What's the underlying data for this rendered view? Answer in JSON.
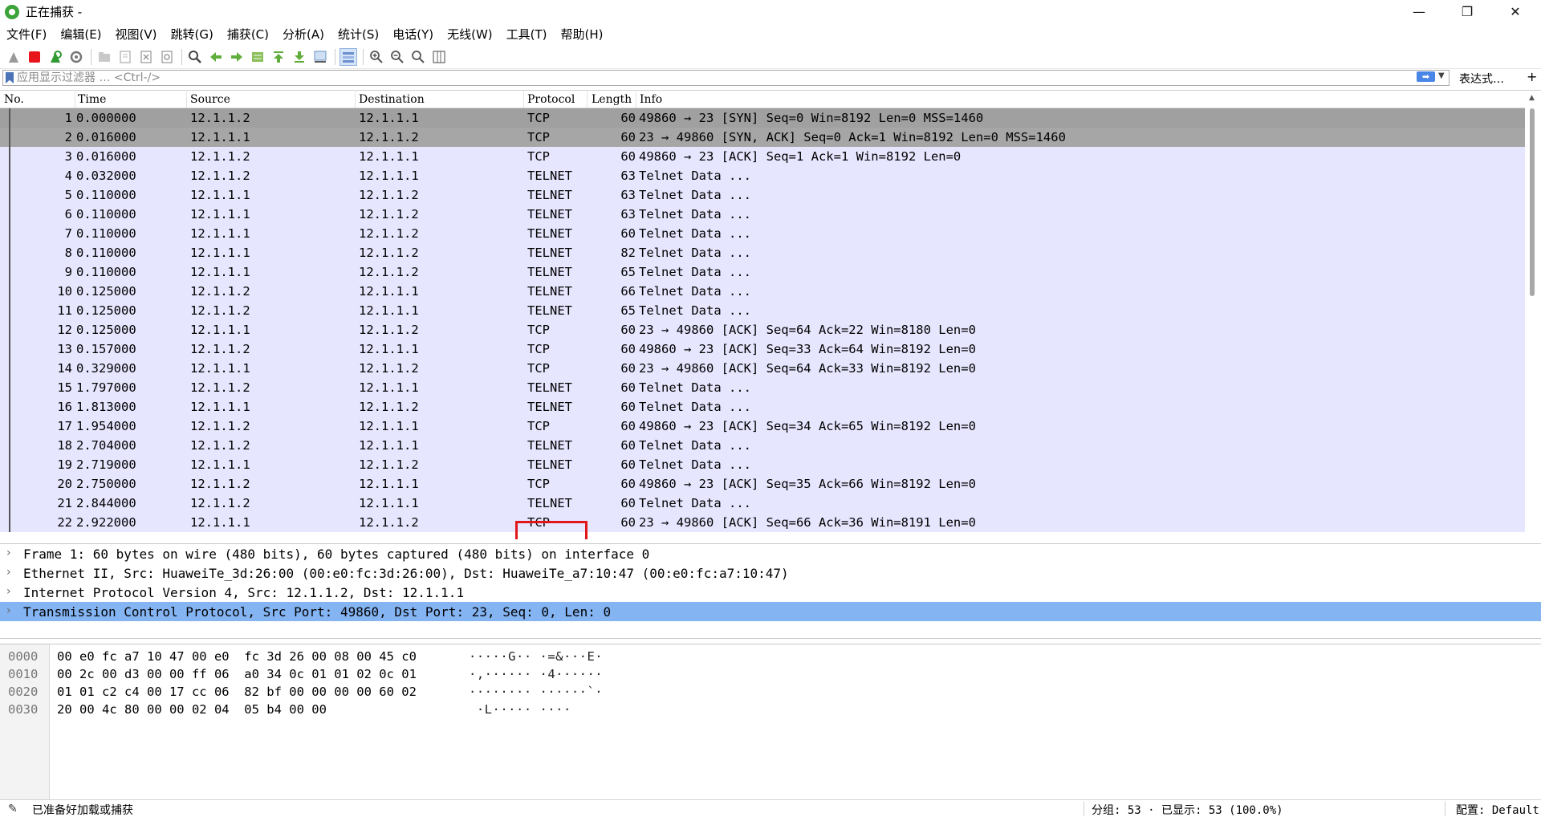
{
  "window": {
    "title": "正在捕获 -",
    "minimize": "—",
    "maximize": "❐",
    "close": "✕"
  },
  "menu": [
    "文件(F)",
    "编辑(E)",
    "视图(V)",
    "跳转(G)",
    "捕获(C)",
    "分析(A)",
    "统计(S)",
    "电话(Y)",
    "无线(W)",
    "工具(T)",
    "帮助(H)"
  ],
  "toolbar_icons": [
    "shark-fin-start-icon",
    "stop-capture-icon",
    "restart-capture-icon",
    "capture-options-icon",
    "open-file-icon",
    "save-file-icon",
    "close-file-icon",
    "reload-file-icon",
    "find-packet-icon",
    "go-back-icon",
    "go-forward-icon",
    "go-to-packet-icon",
    "first-packet-icon",
    "last-packet-icon",
    "auto-scroll-icon",
    "colorize-icon",
    "zoom-in-icon",
    "zoom-out-icon",
    "normal-size-icon",
    "resize-columns-icon"
  ],
  "filter": {
    "placeholder": "应用显示过滤器 … <Ctrl-/>",
    "expression_label": "表达式…",
    "plus_label": "+"
  },
  "packet_list": {
    "columns": [
      "No.",
      "Time",
      "Source",
      "Destination",
      "Protocol",
      "Length",
      "Info"
    ],
    "rows": [
      {
        "no": "1",
        "time": "0.000000",
        "src": "12.1.1.2",
        "dst": "12.1.1.1",
        "proto": "TCP",
        "len": "60",
        "info": "49860 → 23 [SYN] Seq=0 Win=8192 Len=0 MSS=1460"
      },
      {
        "no": "2",
        "time": "0.016000",
        "src": "12.1.1.1",
        "dst": "12.1.1.2",
        "proto": "TCP",
        "len": "60",
        "info": "23 → 49860 [SYN, ACK] Seq=0 Ack=1 Win=8192 Len=0 MSS=1460"
      },
      {
        "no": "3",
        "time": "0.016000",
        "src": "12.1.1.2",
        "dst": "12.1.1.1",
        "proto": "TCP",
        "len": "60",
        "info": "49860 → 23 [ACK] Seq=1 Ack=1 Win=8192 Len=0"
      },
      {
        "no": "4",
        "time": "0.032000",
        "src": "12.1.1.2",
        "dst": "12.1.1.1",
        "proto": "TELNET",
        "len": "63",
        "info": "Telnet Data ..."
      },
      {
        "no": "5",
        "time": "0.110000",
        "src": "12.1.1.1",
        "dst": "12.1.1.2",
        "proto": "TELNET",
        "len": "63",
        "info": "Telnet Data ..."
      },
      {
        "no": "6",
        "time": "0.110000",
        "src": "12.1.1.1",
        "dst": "12.1.1.2",
        "proto": "TELNET",
        "len": "63",
        "info": "Telnet Data ..."
      },
      {
        "no": "7",
        "time": "0.110000",
        "src": "12.1.1.1",
        "dst": "12.1.1.2",
        "proto": "TELNET",
        "len": "60",
        "info": "Telnet Data ..."
      },
      {
        "no": "8",
        "time": "0.110000",
        "src": "12.1.1.1",
        "dst": "12.1.1.2",
        "proto": "TELNET",
        "len": "82",
        "info": "Telnet Data ..."
      },
      {
        "no": "9",
        "time": "0.110000",
        "src": "12.1.1.1",
        "dst": "12.1.1.2",
        "proto": "TELNET",
        "len": "65",
        "info": "Telnet Data ..."
      },
      {
        "no": "10",
        "time": "0.125000",
        "src": "12.1.1.2",
        "dst": "12.1.1.1",
        "proto": "TELNET",
        "len": "66",
        "info": "Telnet Data ..."
      },
      {
        "no": "11",
        "time": "0.125000",
        "src": "12.1.1.2",
        "dst": "12.1.1.1",
        "proto": "TELNET",
        "len": "65",
        "info": "Telnet Data ..."
      },
      {
        "no": "12",
        "time": "0.125000",
        "src": "12.1.1.1",
        "dst": "12.1.1.2",
        "proto": "TCP",
        "len": "60",
        "info": "23 → 49860 [ACK] Seq=64 Ack=22 Win=8180 Len=0"
      },
      {
        "no": "13",
        "time": "0.157000",
        "src": "12.1.1.2",
        "dst": "12.1.1.1",
        "proto": "TCP",
        "len": "60",
        "info": "49860 → 23 [ACK] Seq=33 Ack=64 Win=8192 Len=0"
      },
      {
        "no": "14",
        "time": "0.329000",
        "src": "12.1.1.1",
        "dst": "12.1.1.2",
        "proto": "TCP",
        "len": "60",
        "info": "23 → 49860 [ACK] Seq=64 Ack=33 Win=8192 Len=0"
      },
      {
        "no": "15",
        "time": "1.797000",
        "src": "12.1.1.2",
        "dst": "12.1.1.1",
        "proto": "TELNET",
        "len": "60",
        "info": "Telnet Data ..."
      },
      {
        "no": "16",
        "time": "1.813000",
        "src": "12.1.1.1",
        "dst": "12.1.1.2",
        "proto": "TELNET",
        "len": "60",
        "info": "Telnet Data ..."
      },
      {
        "no": "17",
        "time": "1.954000",
        "src": "12.1.1.2",
        "dst": "12.1.1.1",
        "proto": "TCP",
        "len": "60",
        "info": "49860 → 23 [ACK] Seq=34 Ack=65 Win=8192 Len=0"
      },
      {
        "no": "18",
        "time": "2.704000",
        "src": "12.1.1.2",
        "dst": "12.1.1.1",
        "proto": "TELNET",
        "len": "60",
        "info": "Telnet Data ..."
      },
      {
        "no": "19",
        "time": "2.719000",
        "src": "12.1.1.1",
        "dst": "12.1.1.2",
        "proto": "TELNET",
        "len": "60",
        "info": "Telnet Data ..."
      },
      {
        "no": "20",
        "time": "2.750000",
        "src": "12.1.1.2",
        "dst": "12.1.1.1",
        "proto": "TCP",
        "len": "60",
        "info": "49860 → 23 [ACK] Seq=35 Ack=66 Win=8192 Len=0"
      },
      {
        "no": "21",
        "time": "2.844000",
        "src": "12.1.1.2",
        "dst": "12.1.1.1",
        "proto": "TELNET",
        "len": "60",
        "info": "Telnet Data ..."
      },
      {
        "no": "22",
        "time": "2.922000",
        "src": "12.1.1.1",
        "dst": "12.1.1.2",
        "proto": "TCP",
        "len": "60",
        "info": "23 → 49860 [ACK] Seq=66 Ack=36 Win=8191 Len=0"
      }
    ]
  },
  "details": [
    {
      "text": "Frame 1: 60 bytes on wire (480 bits), 60 bytes captured (480 bits) on interface 0",
      "selected": false
    },
    {
      "text": "Ethernet II, Src: HuaweiTe_3d:26:00 (00:e0:fc:3d:26:00), Dst: HuaweiTe_a7:10:47 (00:e0:fc:a7:10:47)",
      "selected": false
    },
    {
      "text": "Internet Protocol Version 4, Src: 12.1.1.2, Dst: 12.1.1.1",
      "selected": false
    },
    {
      "text": "Transmission Control Protocol, Src Port: 49860, Dst Port: 23, Seq: 0, Len: 0",
      "selected": true
    }
  ],
  "bytes": [
    {
      "offset": "0000",
      "hex": "00 e0 fc a7 10 47 00 e0  fc 3d 26 00 08 00 45 c0",
      "ascii": "·····G·· ·=&···E·"
    },
    {
      "offset": "0010",
      "hex": "00 2c 00 d3 00 00 ff 06  a0 34 0c 01 01 02 0c 01",
      "ascii": "·,······ ·4······"
    },
    {
      "offset": "0020",
      "hex": "01 01 c2 c4 00 17 cc 06  82 bf 00 00 00 00 60 02",
      "ascii": "········ ······`·"
    },
    {
      "offset": "0030",
      "hex": "20 00 4c 80 00 00 02 04  05 b4 00 00",
      "ascii": " ·L····· ····"
    }
  ],
  "status": {
    "ready_text": "已准备好加载或捕获",
    "stats_text": "分组: 53 · 已显示: 53 (100.0%)",
    "profile_text": "配置: Default"
  },
  "colors": {
    "row_default": "#e7e6ff",
    "row_selected": "#a0a0a0",
    "detail_selected": "#84b4f2",
    "highlight_box": "#e0161b"
  }
}
